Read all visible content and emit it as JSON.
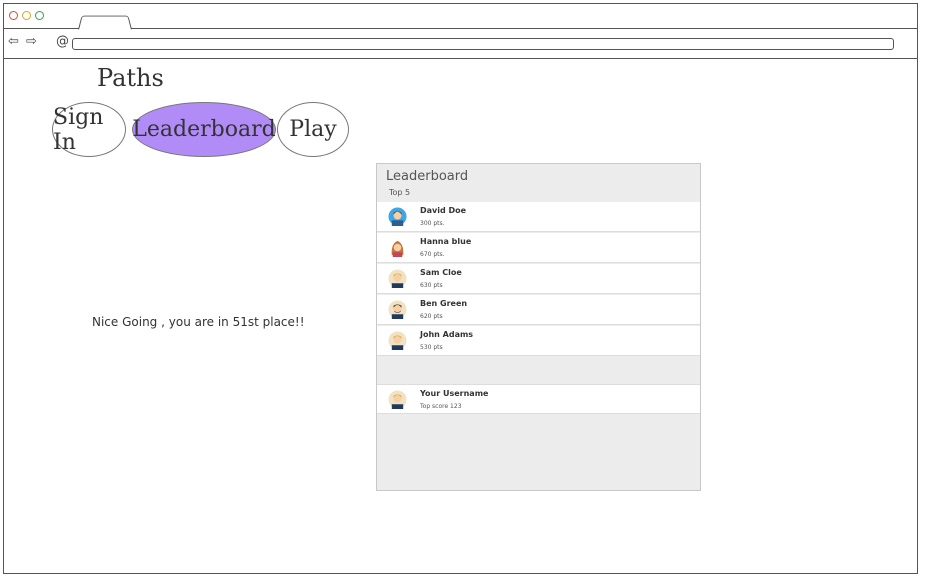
{
  "browser": {
    "back_icon": "arrow-left-icon",
    "forward_icon": "arrow-right-icon",
    "reload_icon": "reload-icon",
    "url": ""
  },
  "app": {
    "title": "Paths",
    "nav": {
      "signin": "Sign In",
      "leaderboard": "Leaderboard",
      "play": "Play"
    },
    "active_color": "#b18cf7",
    "message": "Nice Going , you are in 51st place!!"
  },
  "leaderboard": {
    "title": "Leaderboard",
    "subtitle": "Top 5",
    "entries": [
      {
        "name": "David Doe",
        "score": "300 pts."
      },
      {
        "name": "Hanna blue",
        "score": " 670 pts."
      },
      {
        "name": "Sam Cloe",
        "score": "630 pts"
      },
      {
        "name": "Ben Green",
        "score": "620 pts"
      },
      {
        "name": "John Adams",
        "score": "530 pts"
      }
    ],
    "current_user": {
      "name": "Your Username",
      "score": "Top score 123"
    }
  }
}
